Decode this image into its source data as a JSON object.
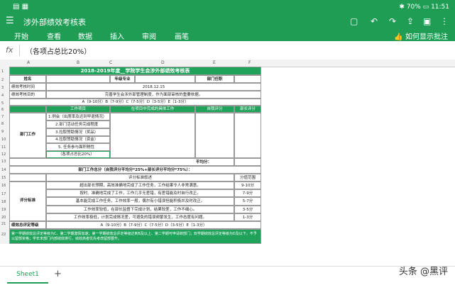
{
  "status": {
    "time": "11:51",
    "battery": "70%"
  },
  "app": {
    "title": "涉外部绩效考核表"
  },
  "menu": {
    "items": [
      "开始",
      "查看",
      "数据",
      "插入",
      "审阅",
      "画笔"
    ],
    "help": "如何显示批注"
  },
  "formula": {
    "fx": "fx",
    "content": "（各项占总比20%）"
  },
  "columns": [
    "A",
    "B",
    "C",
    "D",
    "E",
    "F"
  ],
  "rows": [
    "1",
    "2",
    "3",
    "4",
    "5",
    "6",
    "7",
    "8",
    "9",
    "10",
    "11",
    "12",
    "13",
    "14",
    "15",
    "16",
    "17",
    "18",
    "19",
    "20",
    "21",
    "22"
  ],
  "sheet": {
    "title": "2018-2019年度__学院学生会涉外部绩效考核表",
    "r2": {
      "name": "姓名",
      "major": "年级专业",
      "dept": "部门任职"
    },
    "r3": {
      "label": "绩效考核时间",
      "value": "2018.12.15"
    },
    "r4": {
      "label": "绩效考核目的",
      "value": "完善学生会涉外部管理制度，作为面部审核的重要依据。"
    },
    "r5": "A（9-10分）B（7-9分）C（7-5分）D（3-5分）E（1-3分）",
    "r6": {
      "a": "部门工作",
      "b": "工作项目",
      "c": "在项目中完成的具体工作",
      "d": "自我评分",
      "e": "部长评分"
    },
    "r7": "1.例会（出席率及迟到早退情况）",
    "r8": "2.部门活动任务完成程度",
    "r9": "3.拉取赞助情况（奖品）",
    "r10": "4.拉取赞助情况（资金）",
    "r11": "5. 任务参与面积税性",
    "r12": "（各项占总比20%）",
    "r13": "平均分：",
    "r14": "部门工作总分（自我评分平均分*25%+部长评分平均分*75%）：",
    "r15": {
      "criteria": "评分标准叙述",
      "range": "分值范围"
    },
    "eval_label": "评分标准",
    "r16": {
      "text": "超出部长预期，高效准确地完成了工作任务，工作结果令人非常满意。",
      "range": "9-10分"
    },
    "r17": {
      "text": "按时、准确地完成了工作，工作几乎无差错，有差错能及时自行改正。",
      "range": "7-9分"
    },
    "r18": {
      "text": "基本能完成工作任务，工作效率一般，偶尔有小错误但能积极并及时改正。",
      "range": "5-7分"
    },
    "r19": {
      "text": "工作效率较低，在部长监督下完成计划，结果较差，工作不细心。",
      "range": "3-5分"
    },
    "r20": {
      "text": "工作效率极低，计划完成情况差，可避免的错误频繁发生，工作态度有问题。",
      "range": "1-3分"
    },
    "r21": {
      "label": "绩效总评定等级",
      "value": "A（9-10分）B（7-9分）C（7-5分）D（3-5分）E（1-3分）"
    },
    "r22": "第一学期绩效总评定等级为C、第二学期激情加速；第一学期绩效总评定等级达到B及以上、第二学期可申请转部门；双学期绩效总评定等级为D及以下，不予以留部资格；学年末部门内部绩效排行，绩效高者优先考虑留部晋升。"
  },
  "sheet_tab": "Sheet1",
  "watermark": "头条 @黑评",
  "colors": {
    "accent": "#1f9d55",
    "header_fill": "#1fa35b"
  }
}
